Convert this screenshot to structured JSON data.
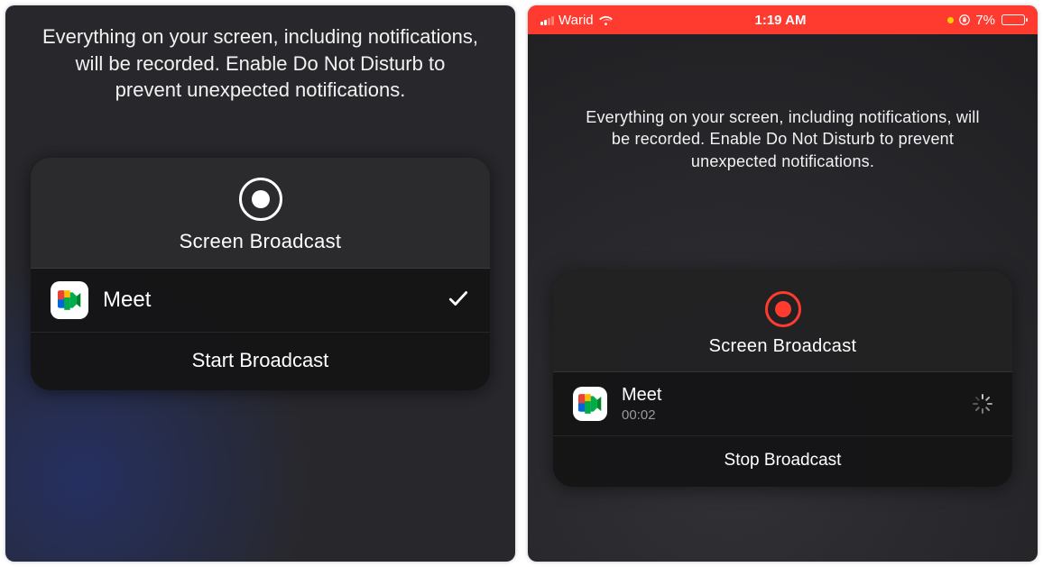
{
  "advisory_text": "Everything on your screen, including notifications, will be recorded. Enable Do Not Disturb to prevent unexpected notifications.",
  "sheet_title": "Screen Broadcast",
  "left": {
    "app": {
      "name": "Meet",
      "selected": true
    },
    "action_label": "Start Broadcast"
  },
  "right": {
    "statusbar": {
      "carrier": "Warid",
      "time": "1:19 AM",
      "battery_percent": "7%"
    },
    "app": {
      "name": "Meet",
      "elapsed": "00:02",
      "loading": true
    },
    "action_label": "Stop Broadcast"
  }
}
